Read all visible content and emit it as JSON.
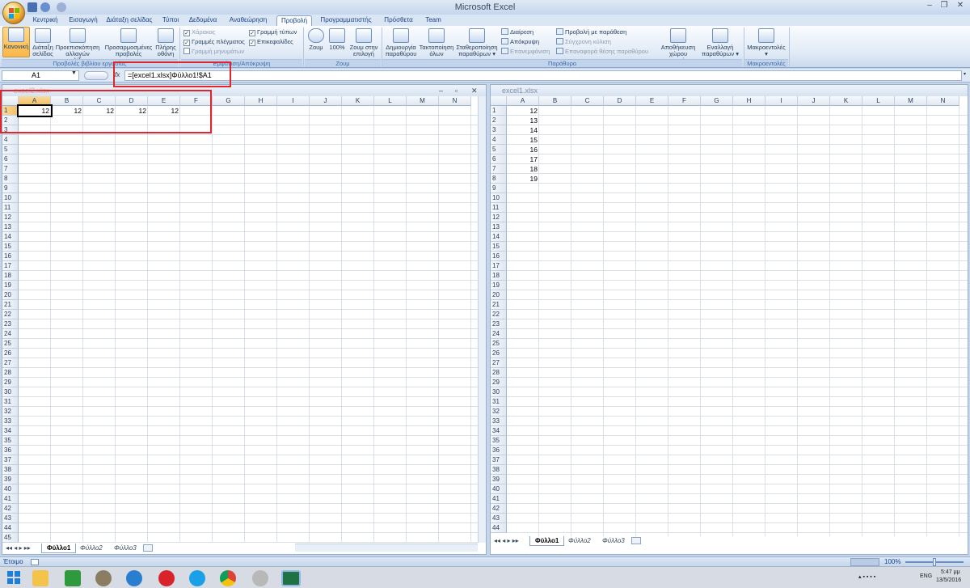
{
  "window": {
    "title": "Microsoft Excel",
    "minimize": "–",
    "restore": "❐",
    "close": "✕"
  },
  "tabs": [
    {
      "label": "Κεντρική"
    },
    {
      "label": "Εισαγωγή"
    },
    {
      "label": "Διάταξη σελίδας"
    },
    {
      "label": "Τύποι"
    },
    {
      "label": "Δεδομένα"
    },
    {
      "label": "Αναθεώρηση"
    },
    {
      "label": "Προβολή"
    },
    {
      "label": "Προγραμματιστής"
    },
    {
      "label": "Πρόσθετα"
    },
    {
      "label": "Team"
    }
  ],
  "ribbon": {
    "views": {
      "normal": "Κανονική",
      "page_layout_1": "Διάταξη",
      "page_layout_2": "σελίδας",
      "page_break_1": "Προεπισκόπηση",
      "page_break_2": "αλλαγών σελίδας",
      "custom_1": "Προσαρμοσμένες",
      "custom_2": "προβολές",
      "full_1": "Πλήρης",
      "full_2": "οθόνη",
      "label": "Προβολές βιβλίου εργασίας"
    },
    "show_hide": {
      "ruler": "Χάρακας",
      "gridlines": "Γραμμές πλέγματος",
      "message_bar": "Γραμμή μηνυμάτων",
      "formula_bar": "Γραμμή τύπων",
      "headings": "Επικεφαλίδες",
      "label": "Εμφάνιση/Απόκρυψη",
      "check": "✓"
    },
    "zoom": {
      "zoom": "Ζουμ",
      "hundred": "100%",
      "selection_1": "Ζουμ στην",
      "selection_2": "επιλογή",
      "label": "Ζουμ"
    },
    "window": {
      "new_1": "Δημιουργία",
      "new_2": "παραθύρου",
      "arrange_1": "Τακτοποίηση",
      "arrange_2": "όλων",
      "freeze_1": "Σταθεροποίηση",
      "freeze_2": "παραθύρων ▾",
      "split": "Διαίρεση",
      "hide": "Απόκρυψη",
      "unhide": "Επανεμφάνιση",
      "side_by_side": "Προβολή με παράθεση",
      "sync_scroll": "Σύγχρονη κύλιση",
      "reset_pos": "Επαναφορά θέσης παραθύρου",
      "save_ws_1": "Αποθήκευση",
      "save_ws_2": "χώρου εργασίας",
      "switch_1": "Εναλλαγή",
      "switch_2": "παραθύρων ▾",
      "label": "Παράθυρο"
    },
    "macros": {
      "macros": "Μακροεντολές",
      "arrow": "▾",
      "label": "Μακροεντολές"
    }
  },
  "formula_bar": {
    "name_box": "A1",
    "fx": "fx",
    "formula": "=[excel1.xlsx]Φύλλο1!$A1"
  },
  "left_workbook": {
    "title": "excel2.xlsx",
    "columns": [
      "A",
      "B",
      "C",
      "D",
      "E",
      "F",
      "G",
      "H",
      "I",
      "J",
      "K",
      "L",
      "M",
      "N"
    ],
    "rows": [
      "1",
      "2",
      "3",
      "4",
      "5",
      "6",
      "7",
      "8",
      "9",
      "10",
      "11",
      "12",
      "13",
      "14",
      "15",
      "16",
      "17",
      "18",
      "19",
      "20",
      "21",
      "22",
      "23",
      "24",
      "25",
      "26",
      "27",
      "28",
      "29",
      "30",
      "31",
      "32",
      "33",
      "34",
      "35",
      "36",
      "37",
      "38",
      "39",
      "40",
      "41",
      "42",
      "43",
      "44",
      "45"
    ],
    "row1_values": [
      "12",
      "12",
      "12",
      "12",
      "12"
    ],
    "sheets": [
      "Φύλλο1",
      "Φύλλο2",
      "Φύλλο3"
    ],
    "win_min": "–",
    "win_max": "▫",
    "win_close": "✕"
  },
  "right_workbook": {
    "title": "excel1.xlsx",
    "columns": [
      "A",
      "B",
      "C",
      "D",
      "E",
      "F",
      "G",
      "H",
      "I",
      "J",
      "K",
      "L",
      "M",
      "N"
    ],
    "rows": [
      "1",
      "2",
      "3",
      "4",
      "5",
      "6",
      "7",
      "8",
      "9",
      "10",
      "11",
      "12",
      "13",
      "14",
      "15",
      "16",
      "17",
      "18",
      "19",
      "20",
      "21",
      "22",
      "23",
      "24",
      "25",
      "26",
      "27",
      "28",
      "29",
      "30",
      "31",
      "32",
      "33",
      "34",
      "35",
      "36",
      "37",
      "38",
      "39",
      "40",
      "41",
      "42",
      "43",
      "44"
    ],
    "colA_values": [
      "12",
      "13",
      "14",
      "15",
      "16",
      "17",
      "18",
      "19"
    ],
    "sheets": [
      "Φύλλο1",
      "Φύλλο2",
      "Φύλλο3"
    ]
  },
  "status": {
    "ready": "Έτοιμο",
    "zoom": "100%"
  },
  "taskbar": {
    "lang": "ENG",
    "time": "5:47 μμ",
    "date": "13/5/2016"
  }
}
